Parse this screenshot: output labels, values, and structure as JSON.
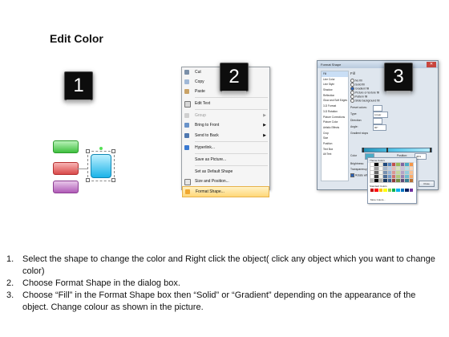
{
  "title": "Edit Color",
  "badges": [
    "1",
    "2",
    "3"
  ],
  "context_menu": {
    "items": [
      {
        "label": "Cut",
        "icon": "scissors-icon"
      },
      {
        "label": "Copy",
        "icon": "copy-icon"
      },
      {
        "label": "Paste",
        "icon": "paste-icon"
      },
      {
        "label": "Edit Text",
        "icon": "edit-text-icon"
      },
      {
        "label": "Group",
        "icon": "group-icon",
        "disabled": true,
        "submenu": true
      },
      {
        "label": "Bring to Front",
        "icon": "bring-front-icon",
        "submenu": true
      },
      {
        "label": "Send to Back",
        "icon": "send-back-icon",
        "submenu": true
      },
      {
        "label": "Hyperlink...",
        "icon": "hyperlink-icon"
      },
      {
        "label": "Save as Picture...",
        "icon": ""
      },
      {
        "label": "Set as Default Shape",
        "icon": ""
      },
      {
        "label": "Size and Position...",
        "icon": "size-icon"
      },
      {
        "label": "Format Shape...",
        "icon": "format-shape-icon",
        "highlighted": true
      }
    ]
  },
  "dialog": {
    "title": "Format Shape",
    "nav": [
      "Fill",
      "Line Color",
      "Line Style",
      "Shadow",
      "Reflection",
      "Glow and Soft Edges",
      "3-D Format",
      "3-D Rotation",
      "Picture Corrections",
      "Picture Color",
      "Artistic Effects",
      "Crop",
      "Size",
      "Position",
      "Text Box",
      "Alt Text"
    ],
    "fill_heading": "Fill",
    "options": [
      "No fill",
      "Solid fill",
      "Gradient fill",
      "Picture or texture fill",
      "Pattern fill",
      "Slide background fill"
    ],
    "preset_label": "Preset colors:",
    "type_label": "Type:",
    "type_value": "Linear",
    "direction_label": "Direction:",
    "angle_label": "Angle:",
    "angle_value": "90°",
    "stops_label": "Gradient stops",
    "color_label": "Color",
    "position_label": "Position:",
    "position_value": "36%",
    "brightness_label": "Brightness:",
    "transparency_label": "Transparency:",
    "rotate_label": "Rotate with shape",
    "palette_heading": "Theme Colors",
    "standard_heading": "Standard Colors",
    "more_colors": "More Colors...",
    "close_label": "Close"
  },
  "colors": {
    "theme": [
      "#ffffff",
      "#000000",
      "#eeece1",
      "#1f497d",
      "#4f81bd",
      "#c0504d",
      "#9bbb59",
      "#8064a2",
      "#4bacc6",
      "#f79646"
    ],
    "standard": [
      "#c00000",
      "#ff0000",
      "#ffc000",
      "#ffff00",
      "#92d050",
      "#00b050",
      "#00b0f0",
      "#0070c0",
      "#002060",
      "#7030a0"
    ]
  },
  "instructions": [
    {
      "num": "1.",
      "text": "Select the shape to change the color and Right click the object( click any object which you want to change color)"
    },
    {
      "num": "2.",
      "text": "Choose Format Shape in the dialog box."
    },
    {
      "num": "3.",
      "text": "Choose “Fill” in the Format Shape box then “Solid” or “Gradient” depending on the appearance of the object. Change colour as shown in the picture."
    }
  ]
}
